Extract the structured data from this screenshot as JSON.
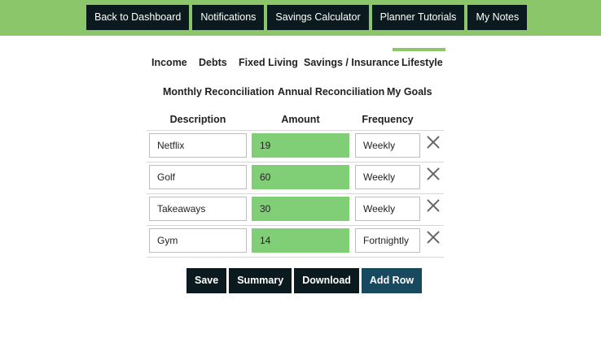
{
  "nav": {
    "items": [
      "Back to Dashboard",
      "Notifications",
      "Savings Calculator",
      "Planner Tutorials",
      "My Notes"
    ]
  },
  "tabs": {
    "row1": [
      "Income",
      "Debts",
      "Fixed Living",
      "Savings / Insurance",
      "Lifestyle"
    ],
    "row2": [
      "Monthly Reconciliation",
      "Annual Reconciliation",
      "My Goals"
    ],
    "active": "Lifestyle"
  },
  "table": {
    "headers": {
      "description": "Description",
      "amount": "Amount",
      "frequency": "Frequency"
    },
    "rows": [
      {
        "description": "Netflix",
        "amount": "19",
        "frequency": "Weekly"
      },
      {
        "description": "Golf",
        "amount": "60",
        "frequency": "Weekly"
      },
      {
        "description": "Takeaways",
        "amount": "30",
        "frequency": "Weekly"
      },
      {
        "description": "Gym",
        "amount": "14",
        "frequency": "Fortnightly"
      }
    ]
  },
  "actions": {
    "save": "Save",
    "summary": "Summary",
    "download": "Download",
    "add_row": "Add Row"
  },
  "colors": {
    "brand_green": "#8bc66a",
    "amount_fill": "#80cf77",
    "dark": "#0a1a1f",
    "add_button": "#174a5e"
  },
  "icons": {
    "delete": "close-icon"
  }
}
